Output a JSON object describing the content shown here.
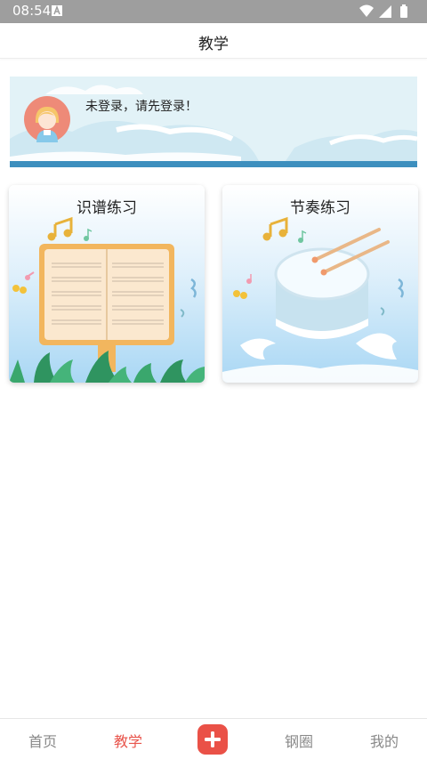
{
  "status_bar": {
    "time": "08:54"
  },
  "header": {
    "title": "教学"
  },
  "banner": {
    "login_text": "未登录，请先登录！"
  },
  "cards": [
    {
      "title": "识谱练习"
    },
    {
      "title": "节奏练习"
    }
  ],
  "tabbar": {
    "items": [
      {
        "label": "首页",
        "active": false
      },
      {
        "label": "教学",
        "active": true
      },
      {
        "label": "钢圈",
        "active": false
      },
      {
        "label": "我的",
        "active": false
      }
    ],
    "add_icon": "plus-icon"
  },
  "colors": {
    "accent": "#e8544b",
    "banner_bg": "#e2f2f7",
    "banner_strip": "#3d8fbe",
    "status_bar": "#9e9e9e"
  }
}
